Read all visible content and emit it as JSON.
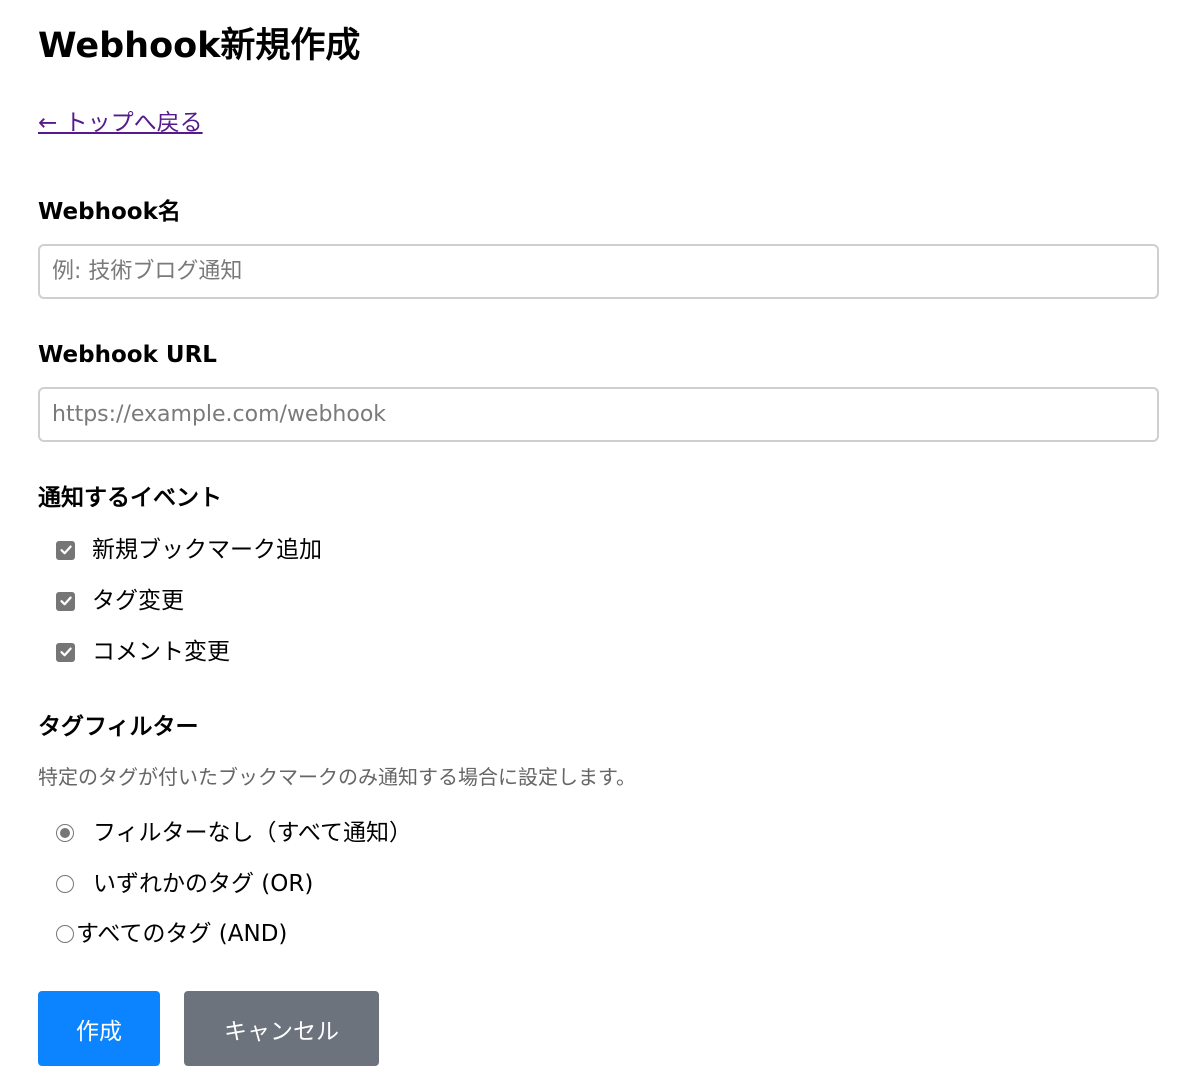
{
  "page": {
    "title": "Webhook新規作成",
    "back_link": "← トップへ戻る"
  },
  "form": {
    "name_field": {
      "label": "Webhook名",
      "placeholder": "例: 技術ブログ通知",
      "value": ""
    },
    "url_field": {
      "label": "Webhook URL",
      "placeholder": "https://example.com/webhook",
      "value": ""
    },
    "events": {
      "title": "通知するイベント",
      "items": [
        {
          "label": "新規ブックマーク追加",
          "checked": true
        },
        {
          "label": "タグ変更",
          "checked": true
        },
        {
          "label": "コメント変更",
          "checked": true
        }
      ]
    },
    "tag_filter": {
      "title": "タグフィルター",
      "help": "特定のタグが付いたブックマークのみ通知する場合に設定します。",
      "options": [
        {
          "label": "フィルターなし（すべて通知）",
          "selected": true
        },
        {
          "label": "いずれかのタグ (OR)",
          "selected": false
        },
        {
          "label": "すべてのタグ (AND)",
          "selected": false
        }
      ]
    },
    "buttons": {
      "submit_label": "作成",
      "cancel_label": "キャンセル"
    }
  },
  "colors": {
    "primary": "#0d84ff",
    "secondary": "#6c737c",
    "link": "#551a8b",
    "control": "#767676"
  },
  "icons": {
    "checkbox": "checkmark-icon",
    "radio": "radio-dot-icon"
  }
}
